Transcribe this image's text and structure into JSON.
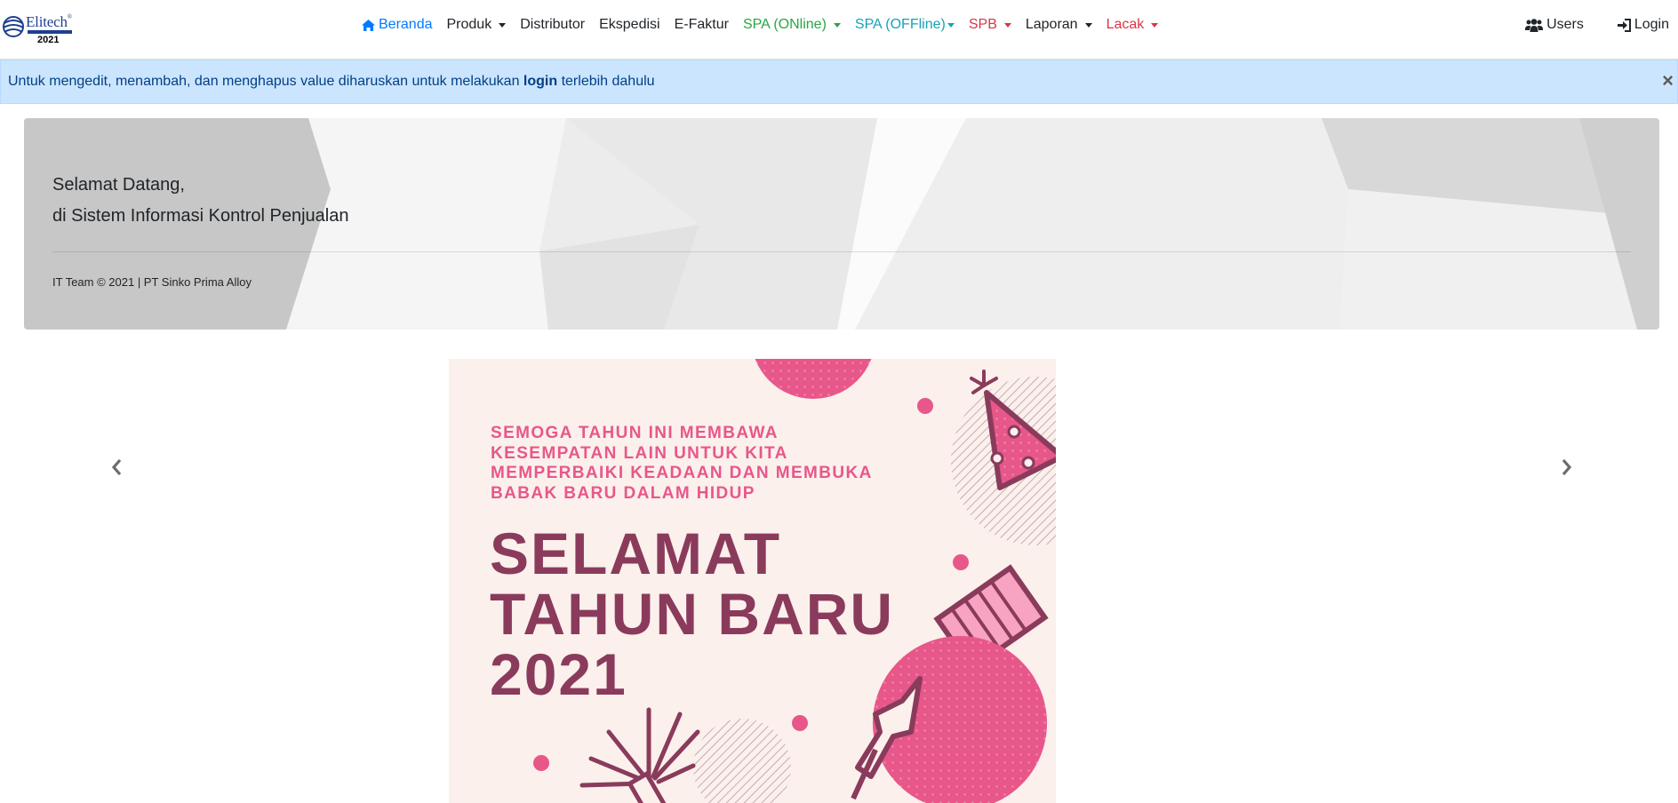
{
  "brand": {
    "name": "Elitech",
    "reg": "®",
    "year": "2021"
  },
  "nav": {
    "items": [
      {
        "label": "Beranda",
        "color": "#007bff",
        "dropdown": false,
        "icon": "home-icon"
      },
      {
        "label": "Produk",
        "color": "#212529",
        "dropdown": true
      },
      {
        "label": "Distributor",
        "color": "#212529",
        "dropdown": false
      },
      {
        "label": "Ekspedisi",
        "color": "#212529",
        "dropdown": false
      },
      {
        "label": "E-Faktur",
        "color": "#212529",
        "dropdown": false
      },
      {
        "label": "SPA (ONline)",
        "color": "#28a745",
        "dropdown": true
      },
      {
        "label": "SPA (OFFline)",
        "color": "#17a2b8",
        "dropdown": true
      },
      {
        "label": "SPB",
        "color": "#dc3545",
        "dropdown": true
      },
      {
        "label": "Laporan",
        "color": "#212529",
        "dropdown": true
      },
      {
        "label": "Lacak",
        "color": "#dc3545",
        "dropdown": true
      }
    ],
    "right": {
      "users_label": "Users",
      "login_label": "Login"
    }
  },
  "alert": {
    "text_before": "Untuk mengedit, menambah, dan menghapus value diharuskan untuk melakukan ",
    "bold": "login",
    "text_after": " terlebih dahulu",
    "close": "×"
  },
  "jumbotron": {
    "line1": "Selamat Datang,",
    "line2": "di Sistem Informasi Kontrol Penjualan",
    "footer": "IT Team © 2021 | PT Sinko Prima Alloy"
  },
  "carousel": {
    "slide": {
      "subtitle_lines": [
        "SEMOGA TAHUN INI MEMBAWA",
        "KESEMPATAN LAIN UNTUK KITA",
        "MEMPERBAIKI KEADAAN DAN MEMBUKA",
        "BABAK BARU DALAM HIDUP"
      ],
      "title_lines": [
        "SELAMAT",
        "TAHUN BARU",
        "2021"
      ]
    },
    "colors": {
      "pink": "#e8578a",
      "plum": "#8a3b5c",
      "bg": "#fbf0ec"
    }
  }
}
